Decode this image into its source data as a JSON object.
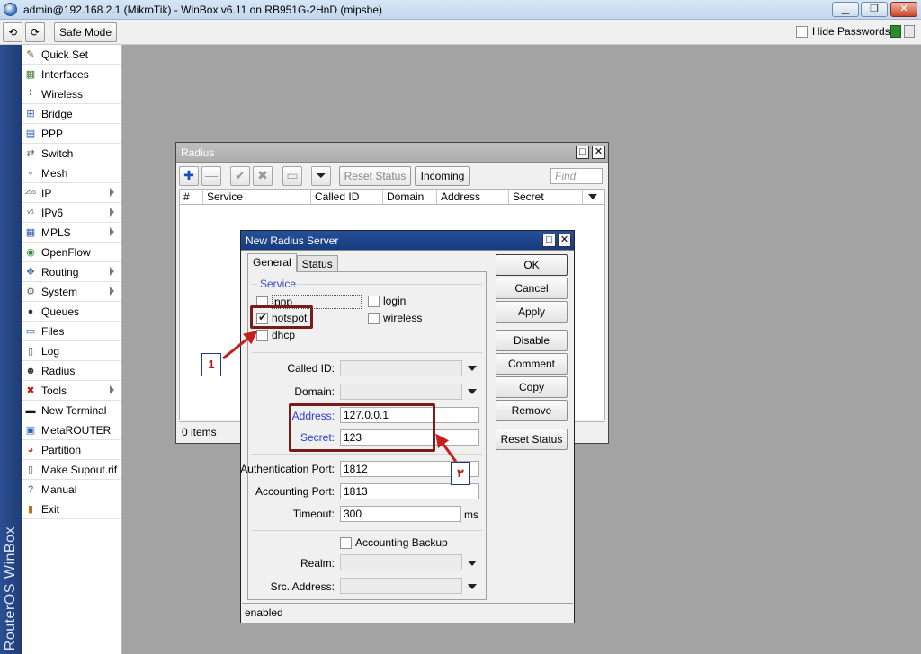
{
  "window": {
    "title": "admin@192.168.2.1 (MikroTik) - WinBox v6.11 on RB951G-2HnD (mipsbe)",
    "minimize": "▁",
    "restore": "❐",
    "close": "✕"
  },
  "toolbar": {
    "undo_icon": "⟲",
    "redo_icon": "⟳",
    "safe_mode": "Safe Mode",
    "hide_passwords": "Hide Passwords"
  },
  "branding": {
    "vertical_text": "RouterOS WinBox"
  },
  "sidebar": {
    "items": [
      {
        "label": "Quick Set",
        "icon": "quickset-icon",
        "glyph": "✎",
        "color": "#7a5a1a",
        "arrow": false
      },
      {
        "label": "Interfaces",
        "icon": "interfaces-icon",
        "glyph": "▦",
        "color": "#3a7a2a",
        "arrow": false
      },
      {
        "label": "Wireless",
        "icon": "wireless-icon",
        "glyph": "⌇",
        "color": "#555555",
        "arrow": false
      },
      {
        "label": "Bridge",
        "icon": "bridge-icon",
        "glyph": "⊞",
        "color": "#2a62b8",
        "arrow": false
      },
      {
        "label": "PPP",
        "icon": "ppp-icon",
        "glyph": "▤",
        "color": "#2a62b8",
        "arrow": false
      },
      {
        "label": "Switch",
        "icon": "switch-icon",
        "glyph": "⇄",
        "color": "#555555",
        "arrow": false
      },
      {
        "label": "Mesh",
        "icon": "mesh-icon",
        "glyph": "∘",
        "color": "#2a62b8",
        "arrow": false
      },
      {
        "label": "IP",
        "icon": "ip-icon",
        "glyph": "255",
        "color": "#555555",
        "arrow": true
      },
      {
        "label": "IPv6",
        "icon": "ipv6-icon",
        "glyph": "v6",
        "color": "#555555",
        "arrow": true
      },
      {
        "label": "MPLS",
        "icon": "mpls-icon",
        "glyph": "▦",
        "color": "#2a62b8",
        "arrow": true
      },
      {
        "label": "OpenFlow",
        "icon": "openflow-icon",
        "glyph": "◉",
        "color": "#2a8a2a",
        "arrow": false
      },
      {
        "label": "Routing",
        "icon": "routing-icon",
        "glyph": "✥",
        "color": "#2a62b8",
        "arrow": true
      },
      {
        "label": "System",
        "icon": "system-icon",
        "glyph": "⚙",
        "color": "#666666",
        "arrow": true
      },
      {
        "label": "Queues",
        "icon": "queues-icon",
        "glyph": "●",
        "color": "#333333",
        "arrow": false
      },
      {
        "label": "Files",
        "icon": "files-icon",
        "glyph": "▭",
        "color": "#2a62b8",
        "arrow": false
      },
      {
        "label": "Log",
        "icon": "log-icon",
        "glyph": "▯",
        "color": "#555555",
        "arrow": false
      },
      {
        "label": "Radius",
        "icon": "radius-icon",
        "glyph": "☻",
        "color": "#333333",
        "arrow": false
      },
      {
        "label": "Tools",
        "icon": "tools-icon",
        "glyph": "✖",
        "color": "#b02020",
        "arrow": true
      },
      {
        "label": "New Terminal",
        "icon": "terminal-icon",
        "glyph": "▬",
        "color": "#111111",
        "arrow": false
      },
      {
        "label": "MetaROUTER",
        "icon": "metarouter-icon",
        "glyph": "▣",
        "color": "#2a62b8",
        "arrow": false
      },
      {
        "label": "Partition",
        "icon": "partition-icon",
        "glyph": "◕",
        "color": "#d04020",
        "arrow": false
      },
      {
        "label": "Make Supout.rif",
        "icon": "supout-icon",
        "glyph": "▯",
        "color": "#555555",
        "arrow": false
      },
      {
        "label": "Manual",
        "icon": "manual-icon",
        "glyph": "?",
        "color": "#2a62b8",
        "arrow": false
      },
      {
        "label": "Exit",
        "icon": "exit-icon",
        "glyph": "▮",
        "color": "#c07020",
        "arrow": false
      }
    ]
  },
  "radius_window": {
    "title": "Radius",
    "add_icon": "✚",
    "remove_icon": "—",
    "enable_icon": "✔",
    "disable_icon": "✖",
    "comment_icon": "▭",
    "filter_icon": "⏷",
    "reset_status": "Reset Status",
    "incoming": "Incoming",
    "find_placeholder": "Find",
    "columns": [
      "#",
      "Service",
      "Called ID",
      "Domain",
      "Address",
      "Secret"
    ],
    "status": "0 items"
  },
  "dialog": {
    "title": "New Radius Server",
    "tabs": [
      "General",
      "Status"
    ],
    "service_label": "Service",
    "services": {
      "ppp": "ppp",
      "login": "login",
      "hotspot": "hotspot",
      "wireless": "wireless",
      "dhcp": "dhcp"
    },
    "fields": {
      "called_id": {
        "label": "Called ID:",
        "value": ""
      },
      "domain": {
        "label": "Domain:",
        "value": ""
      },
      "address": {
        "label": "Address:",
        "value": "127.0.0.1"
      },
      "secret": {
        "label": "Secret:",
        "value": "123"
      },
      "auth_port": {
        "label": "Authentication Port:",
        "value": "1812"
      },
      "acct_port": {
        "label": "Accounting Port:",
        "value": "1813"
      },
      "timeout": {
        "label": "Timeout:",
        "value": "300",
        "unit": "ms"
      },
      "accounting_backup": "Accounting Backup",
      "realm": {
        "label": "Realm:",
        "value": ""
      },
      "src_address": {
        "label": "Src. Address:",
        "value": ""
      }
    },
    "buttons": [
      "OK",
      "Cancel",
      "Apply",
      "Disable",
      "Comment",
      "Copy",
      "Remove",
      "Reset Status"
    ],
    "status": "enabled"
  },
  "annotations": {
    "callout1": "1",
    "callout2": "٢"
  },
  "colors": {
    "accent": "#163c7f",
    "highlight": "#7a1b1b",
    "arrow": "#c81e1e"
  }
}
